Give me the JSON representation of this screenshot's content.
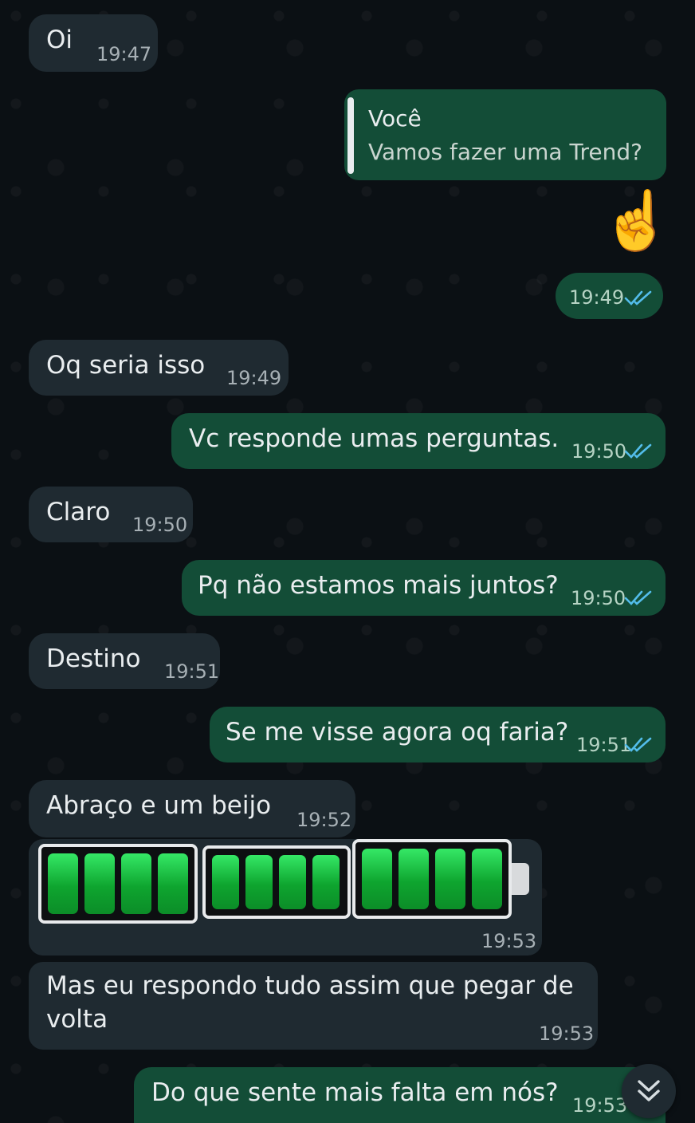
{
  "messages": [
    {
      "direction": "in",
      "text": "Oi",
      "time": "19:47"
    },
    {
      "direction": "out",
      "quote": {
        "author": "Você",
        "text": "Vamos fazer uma Trend?"
      },
      "emoji": "☝️",
      "time": "19:49",
      "status": "read"
    },
    {
      "direction": "in",
      "text": "Oq seria isso",
      "time": "19:49"
    },
    {
      "direction": "out",
      "text": "Vc responde umas perguntas.",
      "time": "19:50",
      "status": "read"
    },
    {
      "direction": "in",
      "text": "Claro",
      "time": "19:50"
    },
    {
      "direction": "out",
      "text": "Pq não estamos mais juntos?",
      "time": "19:50",
      "status": "read"
    },
    {
      "direction": "in",
      "text": "Destino",
      "time": "19:51"
    },
    {
      "direction": "out",
      "text": "Se me visse agora oq faria?",
      "time": "19:51",
      "status": "read"
    },
    {
      "direction": "in",
      "text": "Abraço e um beijo",
      "time": "19:52"
    },
    {
      "direction": "in",
      "media": "battery-stickers",
      "time": "19:53"
    },
    {
      "direction": "in",
      "text_line1": "Mas eu respondo tudo assim que pegar de",
      "text_line2": "volta",
      "time": "19:53"
    },
    {
      "direction": "out",
      "text": "Do que sente mais falta em nós?",
      "time": "19:53",
      "status": "read"
    }
  ],
  "colors": {
    "incoming": "#1f2a31",
    "outgoing": "#134d37",
    "read_ticks": "#53bdeb",
    "background": "#0b1014"
  },
  "icons": {
    "read": "double-check-icon",
    "scroll": "chevron-double-down-icon"
  }
}
